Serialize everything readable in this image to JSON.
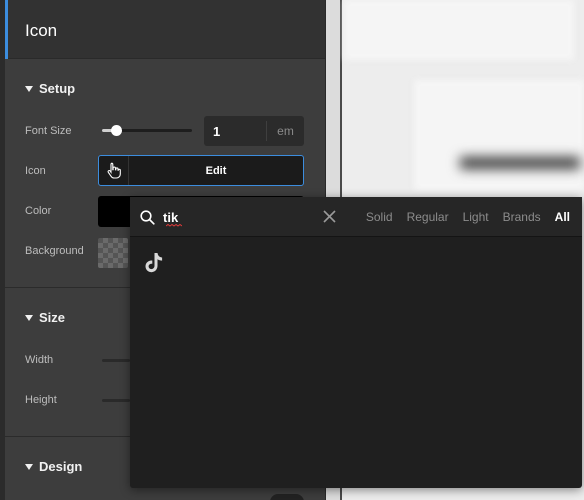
{
  "panel": {
    "title": "Icon",
    "sections": {
      "setup": {
        "title": "Setup",
        "font_size_label": "Font Size",
        "font_size_value": "1",
        "font_size_unit": "em",
        "font_size_slider_fraction": 0.15,
        "icon_label": "Icon",
        "icon_button": "Edit",
        "color_label": "Color",
        "color_value": "#000000",
        "background_label": "Background"
      },
      "size": {
        "title": "Size",
        "width_label": "Width",
        "height_label": "Height"
      },
      "design": {
        "title": "Design"
      }
    }
  },
  "picker": {
    "search_value": "tik",
    "filters": [
      "Solid",
      "Regular",
      "Light",
      "Brands",
      "All"
    ],
    "active_filter": "All",
    "results": [
      {
        "icon": "tiktok-icon"
      }
    ]
  },
  "colors": {
    "accent": "#3c8dde",
    "panel_bg": "#3d3d3d",
    "picker_bg": "#1f1f1f"
  }
}
